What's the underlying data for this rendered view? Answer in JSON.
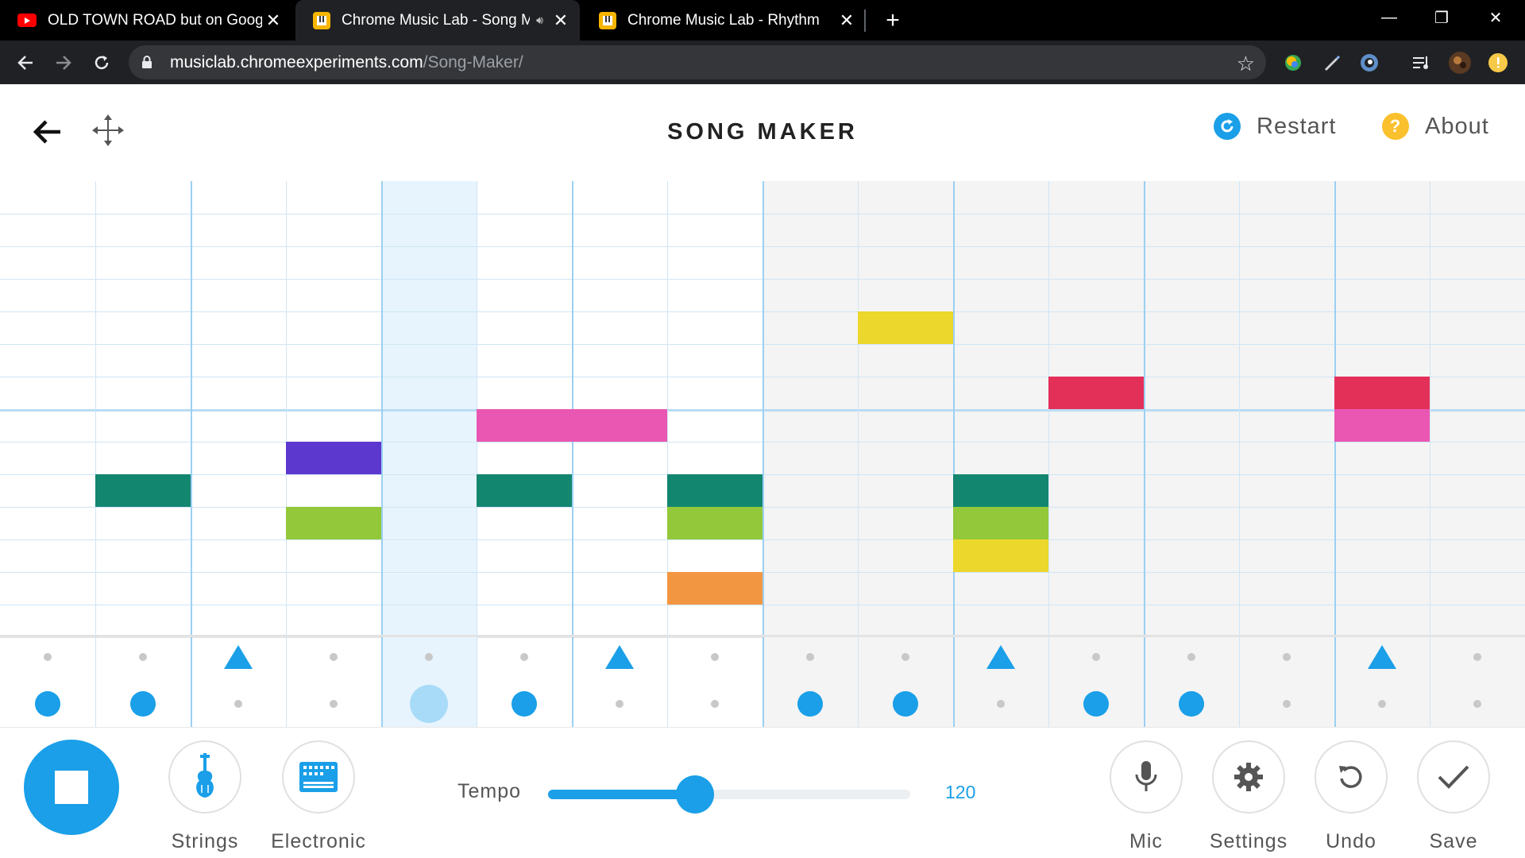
{
  "browser": {
    "tabs": [
      {
        "title": "OLD TOWN ROAD but on Google",
        "favicon": "youtube-icon"
      },
      {
        "title": "Chrome Music Lab - Song Ma",
        "favicon": "music-lab-icon",
        "audio": true
      },
      {
        "title": "Chrome Music Lab - Rhythm",
        "favicon": "music-lab-icon"
      }
    ],
    "url_host": "musiclab.chromeexperiments.com",
    "url_path": "/Song-Maker/"
  },
  "header": {
    "title": "SONG MAKER",
    "restart_label": "Restart",
    "about_label": "About",
    "about_glyph": "?"
  },
  "grid": {
    "columns": 16,
    "rows": 14,
    "playhead_column": 4,
    "light_region_columns": 8,
    "notes": [
      {
        "col": 1,
        "row": 9,
        "color": "#138670"
      },
      {
        "col": 3,
        "row": 8,
        "color": "#5c38cf"
      },
      {
        "col": 3,
        "row": 10,
        "color": "#92c83a"
      },
      {
        "col": 5,
        "row": 7,
        "color": "#e957b2"
      },
      {
        "col": 6,
        "row": 7,
        "color": "#e957b2"
      },
      {
        "col": 5,
        "row": 9,
        "color": "#138670"
      },
      {
        "col": 7,
        "row": 9,
        "color": "#138670"
      },
      {
        "col": 7,
        "row": 10,
        "color": "#92c83a"
      },
      {
        "col": 7,
        "row": 12,
        "color": "#f39641"
      },
      {
        "col": 9,
        "row": 4,
        "color": "#ecd72c"
      },
      {
        "col": 10,
        "row": 9,
        "color": "#138670"
      },
      {
        "col": 10,
        "row": 10,
        "color": "#92c83a"
      },
      {
        "col": 10,
        "row": 11,
        "color": "#ecd72c"
      },
      {
        "col": 11,
        "row": 6,
        "color": "#e33059"
      },
      {
        "col": 14,
        "row": 6,
        "color": "#e33059"
      },
      {
        "col": 14,
        "row": 7,
        "color": "#e957b2"
      }
    ]
  },
  "percussion": {
    "top_row": [
      "dot",
      "dot",
      "triangle",
      "dot",
      "dot",
      "dot",
      "triangle",
      "dot",
      "dot",
      "dot",
      "triangle",
      "dot",
      "dot",
      "dot",
      "triangle",
      "dot"
    ],
    "bottom_row": [
      "circle",
      "circle",
      "dot",
      "dot",
      "circle-active",
      "circle",
      "dot",
      "dot",
      "circle",
      "circle",
      "dot",
      "circle",
      "circle",
      "dot",
      "dot",
      "dot"
    ]
  },
  "controls": {
    "instrument_label": "Strings",
    "percussion_label": "Electronic",
    "tempo_label": "Tempo",
    "tempo_value": "120",
    "tempo_fraction": 0.405,
    "mic_label": "Mic",
    "settings_label": "Settings",
    "undo_label": "Undo",
    "save_label": "Save"
  },
  "colors": {
    "accent": "#1a9fe8",
    "about_yellow": "#fbc02d",
    "grid_line": "#cfe5f6",
    "playhead": "#e8f4fd",
    "shaded_region": "#f4f4f4"
  }
}
